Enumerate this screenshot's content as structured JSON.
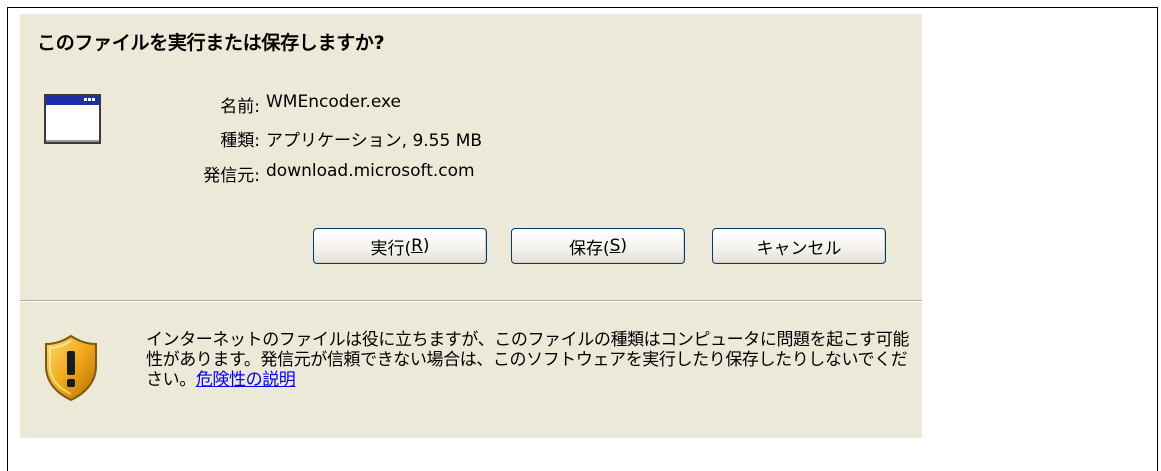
{
  "dialog": {
    "question": "このファイルを実行または保存しますか?",
    "file_icon": "application-window-icon",
    "info": [
      {
        "label": "名前:",
        "value": "WMEncoder.exe"
      },
      {
        "label": "種類:",
        "value": "アプリケーション, 9.55 MB"
      },
      {
        "label": "発信元:",
        "value": "download.microsoft.com"
      }
    ],
    "buttons": {
      "run": {
        "text": "実行(",
        "key": "R",
        "suffix": ")"
      },
      "save": {
        "text": "保存(",
        "key": "S",
        "suffix": ")"
      },
      "cancel": {
        "text": "キャンセル"
      }
    },
    "warning": {
      "icon": "security-shield-warning-icon",
      "text": "インターネットのファイルは役に立ちますが、このファイルの種類はコンピュータに問題を起こす可能性があります。発信元が信頼できない場合は、このソフトウェアを実行したり保存したりしないでください。",
      "link": "危険性の説明"
    }
  },
  "colors": {
    "dialog_bg": "#ece9d8",
    "button_border": "#003c74",
    "link": "#0000ee",
    "shield_gold": "#e8a317"
  }
}
